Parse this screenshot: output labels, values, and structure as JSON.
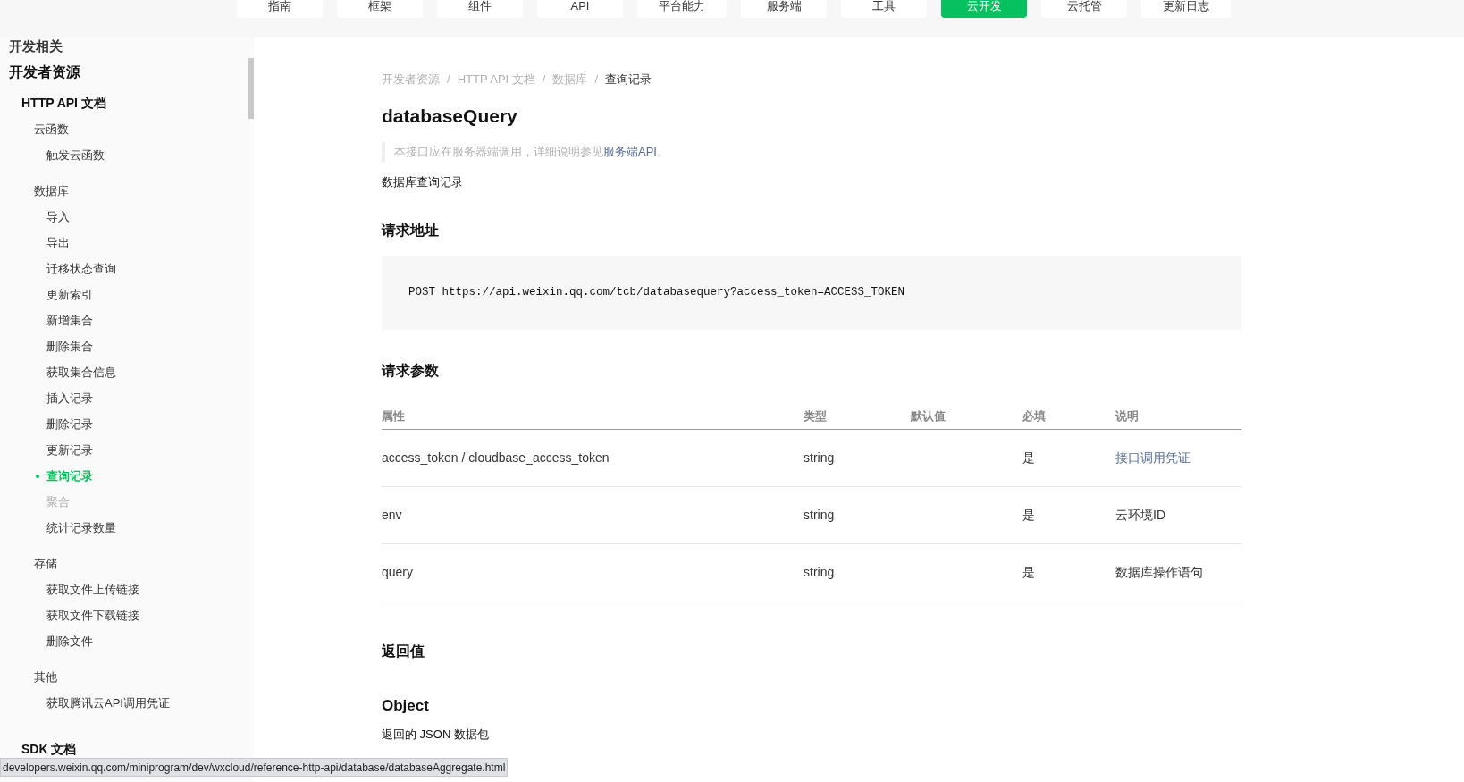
{
  "top_nav": [
    {
      "label": "指南",
      "selected": false
    },
    {
      "label": "框架",
      "selected": false
    },
    {
      "label": "组件",
      "selected": false
    },
    {
      "label": "API",
      "selected": false
    },
    {
      "label": "平台能力",
      "selected": false
    },
    {
      "label": "服务端",
      "selected": false
    },
    {
      "label": "工具",
      "selected": false
    },
    {
      "label": "云开发",
      "selected": true
    },
    {
      "label": "云托管",
      "selected": false
    },
    {
      "label": "更新日志",
      "selected": false
    }
  ],
  "sidebar": {
    "cut_heading": "开发相关",
    "tree": [
      {
        "label": "开发者资源",
        "children": [
          {
            "label": "HTTP API 文档",
            "children": [
              {
                "label": "云函数",
                "children": [
                  {
                    "label": "触发云函数",
                    "selected": false,
                    "disabled": false
                  }
                ]
              },
              {
                "label": "数据库",
                "children": [
                  {
                    "label": "导入",
                    "selected": false,
                    "disabled": false
                  },
                  {
                    "label": "导出",
                    "selected": false,
                    "disabled": false
                  },
                  {
                    "label": "迁移状态查询",
                    "selected": false,
                    "disabled": false
                  },
                  {
                    "label": "更新索引",
                    "selected": false,
                    "disabled": false
                  },
                  {
                    "label": "新增集合",
                    "selected": false,
                    "disabled": false
                  },
                  {
                    "label": "删除集合",
                    "selected": false,
                    "disabled": false
                  },
                  {
                    "label": "获取集合信息",
                    "selected": false,
                    "disabled": false
                  },
                  {
                    "label": "插入记录",
                    "selected": false,
                    "disabled": false
                  },
                  {
                    "label": "删除记录",
                    "selected": false,
                    "disabled": false
                  },
                  {
                    "label": "更新记录",
                    "selected": false,
                    "disabled": false
                  },
                  {
                    "label": "查询记录",
                    "selected": true,
                    "disabled": false
                  },
                  {
                    "label": "聚合",
                    "selected": false,
                    "disabled": true
                  },
                  {
                    "label": "统计记录数量",
                    "selected": false,
                    "disabled": false
                  }
                ]
              },
              {
                "label": "存储",
                "children": [
                  {
                    "label": "获取文件上传链接",
                    "selected": false,
                    "disabled": false
                  },
                  {
                    "label": "获取文件下载链接",
                    "selected": false,
                    "disabled": false
                  },
                  {
                    "label": "删除文件",
                    "selected": false,
                    "disabled": false
                  }
                ]
              },
              {
                "label": "其他",
                "children": [
                  {
                    "label": "获取腾讯云API调用凭证",
                    "selected": false,
                    "disabled": false
                  }
                ]
              }
            ]
          },
          {
            "label": "SDK 文档"
          }
        ]
      }
    ]
  },
  "breadcrumb": [
    {
      "label": "开发者资源"
    },
    {
      "separator": "/",
      "label": "HTTP API 文档"
    },
    {
      "separator": "/",
      "label": "数据库"
    },
    {
      "separator": "/",
      "label": "查询记录"
    }
  ],
  "title": "databaseQuery",
  "note": {
    "text": "本接口应在服务器端调用，详细说明参见",
    "link": "服务端API",
    "end": "。"
  },
  "description": "数据库查询记录",
  "request_url": {
    "heading": "请求地址",
    "code": "POST https://api.weixin.qq.com/tcb/databasequery?access_token=ACCESS_TOKEN"
  },
  "request_params": {
    "heading": "请求参数",
    "columns": [
      "属性",
      "类型",
      "默认值",
      "必填",
      "说明"
    ],
    "rows": [
      {
        "cells": [
          "access_token / cloudbase_access_token",
          "string",
          "",
          "是",
          "接口调用凭证"
        ],
        "description_link": true
      },
      {
        "cells": [
          "env",
          "string",
          "",
          "是",
          "云环境ID"
        ],
        "description_link": false
      },
      {
        "cells": [
          "query",
          "string",
          "",
          "是",
          "数据库操作语句"
        ],
        "description_link": false
      }
    ]
  },
  "return_value": {
    "heading": "返回值",
    "type_heading": "Object",
    "description": "返回的 JSON 数据包"
  },
  "status_bar": {
    "url": "developers.weixin.qq.com/miniprogram/dev/wxcloud/reference-http-api/database/databaseAggregate.html"
  }
}
